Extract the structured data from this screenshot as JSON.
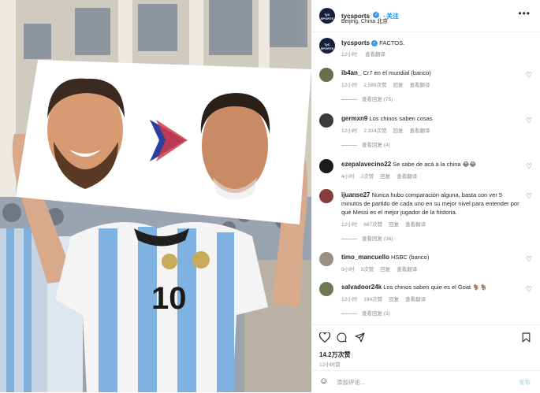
{
  "post": {
    "username": "tycsports",
    "follow_label": "关注",
    "location": "Beijing, China 北京",
    "more_icon": "more-horizontal-icon",
    "avatar_text": "TyC SPORTS"
  },
  "caption": {
    "username": "tycsports",
    "text": "FACTOS.",
    "time": "12小时",
    "translate": "查看翻译"
  },
  "comments": [
    {
      "user": "ib4an_",
      "text": "Cr7 en el mundial (banco)",
      "time": "12小时",
      "likes": "2,589次赞",
      "reply": "回复",
      "translate": "查看翻译",
      "replies": "查看回复 (75)",
      "avatar_color": "#6a6e4a"
    },
    {
      "user": "germxn9",
      "text": "Los chinos saben cosas",
      "time": "12小时",
      "likes": "2,334次赞",
      "reply": "回复",
      "translate": "查看翻译",
      "replies": "查看回复 (4)",
      "avatar_color": "#3b3b3b"
    },
    {
      "user": "ezepalavecino22",
      "text": "Se sabe de acá a la china 😂😂",
      "time": "4小时",
      "likes": "2次赞",
      "reply": "回复",
      "translate": "查看翻译",
      "replies": "",
      "avatar_color": "#1c1c1c"
    },
    {
      "user": "ijuanse27",
      "text": "Nunca hubo comparación alguna, basta con ver 5 minutos de partido de cada uno en su mejor nivel para entender por qué Messi es el mejor jugador de la historia.",
      "time": "12小时",
      "likes": "687次赞",
      "reply": "回复",
      "translate": "查看翻译",
      "replies": "查看回复 (36)",
      "avatar_color": "#8a3b3b"
    },
    {
      "user": "timo_mancuello",
      "text": "HSBC (banco)",
      "time": "9小时",
      "likes": "3次赞",
      "reply": "回复",
      "translate": "查看翻译",
      "replies": "",
      "avatar_color": "#9a8f80"
    },
    {
      "user": "salvadoor24k",
      "text": "Los chinos saben quie es el Goat 🐐🐐",
      "time": "12小时",
      "likes": "194次赞",
      "reply": "回复",
      "translate": "查看翻译",
      "replies": "查看回复 (3)",
      "avatar_color": "#6b7a52"
    }
  ],
  "actions": {
    "likes": "14.2万次赞",
    "time": "12小时前"
  },
  "add_comment": {
    "placeholder": "添加评论...",
    "post_label": "发布"
  }
}
